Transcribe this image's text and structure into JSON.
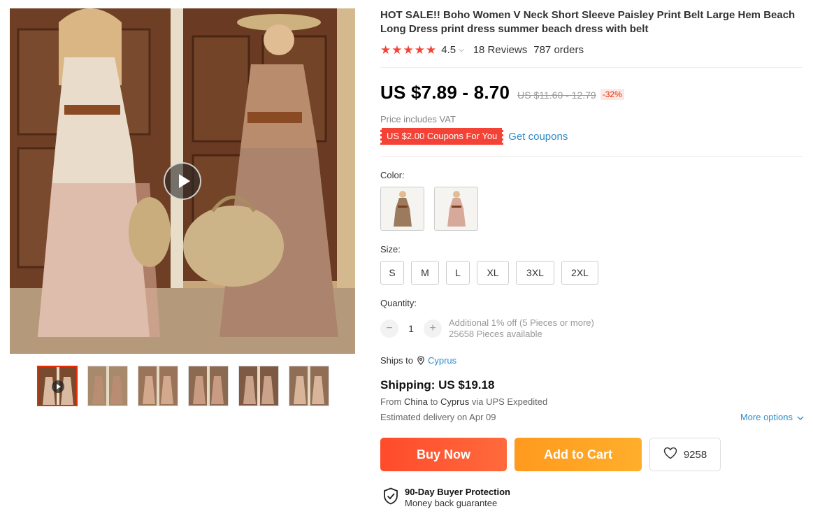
{
  "product": {
    "title": "HOT SALE!! Boho Women V Neck Short Sleeve Paisley Print Belt Large Hem Beach Long Dress print dress summer beach dress with belt",
    "rating": 4.5,
    "rating_text": "4.5",
    "reviews": "18 Reviews",
    "orders": "787 orders"
  },
  "pricing": {
    "price": "US $7.89 - 8.70",
    "original_price": "US $11.60 - 12.79",
    "discount": "-32%",
    "vat_note": "Price includes VAT",
    "coupon_badge": "US $2.00 Coupons For You",
    "get_coupons": "Get coupons"
  },
  "options": {
    "color_label": "Color:",
    "colors": [
      "paisley-print",
      "floral-print"
    ],
    "size_label": "Size:",
    "sizes": [
      "S",
      "M",
      "L",
      "XL",
      "3XL",
      "2XL"
    ],
    "quantity_label": "Quantity:",
    "quantity": "1",
    "quantity_minus": "−",
    "quantity_plus": "+",
    "bulk_note": "Additional 1% off (5 Pieces or more)",
    "available": "25658 Pieces available"
  },
  "shipping": {
    "ships_to_label": "Ships to",
    "ships_to_country": "Cyprus",
    "cost": "Shipping: US $19.18",
    "from_prefix": "From",
    "from_country": "China",
    "to_word": "to",
    "to_country": "Cyprus",
    "via": "via UPS Expedited",
    "estimated": "Estimated delivery on Apr 09",
    "more_options": "More options"
  },
  "actions": {
    "buy_now": "Buy Now",
    "add_to_cart": "Add to Cart",
    "wishlist_count": "9258"
  },
  "protection": {
    "title": "90-Day Buyer Protection",
    "subtitle": "Money back guarantee"
  },
  "gallery": {
    "thumbnail_count": 6,
    "active_thumbnail": 0
  },
  "colors": {
    "accent_red": "#f44336",
    "link_blue": "#2e8bc9",
    "buy_now": "#ff5722",
    "add_to_cart": "#ffa41c",
    "discount_red": "#e62e04"
  }
}
